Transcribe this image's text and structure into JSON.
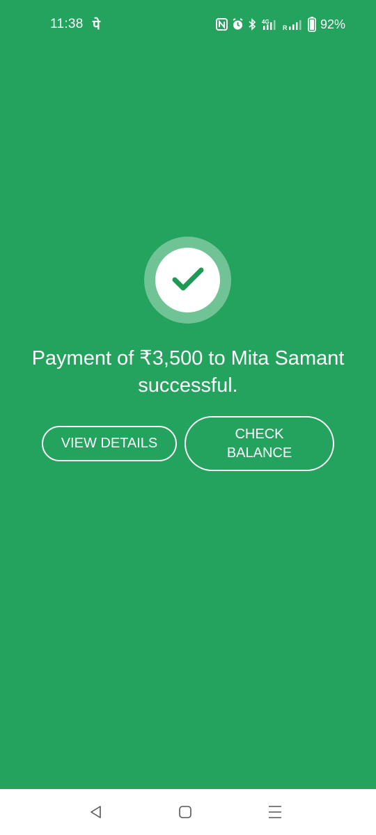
{
  "status_bar": {
    "time": "11:38",
    "app_glyph": "पे",
    "network_label": "4G",
    "roaming_label": "R",
    "battery_percent": "92%",
    "icons": [
      "nfc-icon",
      "alarm-icon",
      "bluetooth-icon",
      "mobile-data-icon",
      "signal-icon",
      "battery-icon"
    ]
  },
  "success": {
    "icon": "checkmark-icon",
    "message": "Payment of ₹3,500 to Mita Samant successful."
  },
  "actions": {
    "view_details_label": "VIEW DETAILS",
    "check_balance_label": "CHECK BALANCE"
  },
  "navigation": {
    "icons": [
      "back-icon",
      "home-icon",
      "recents-icon"
    ]
  },
  "colors": {
    "background": "#23a35d",
    "check": "#1f9a55",
    "navbar": "#ffffff"
  }
}
